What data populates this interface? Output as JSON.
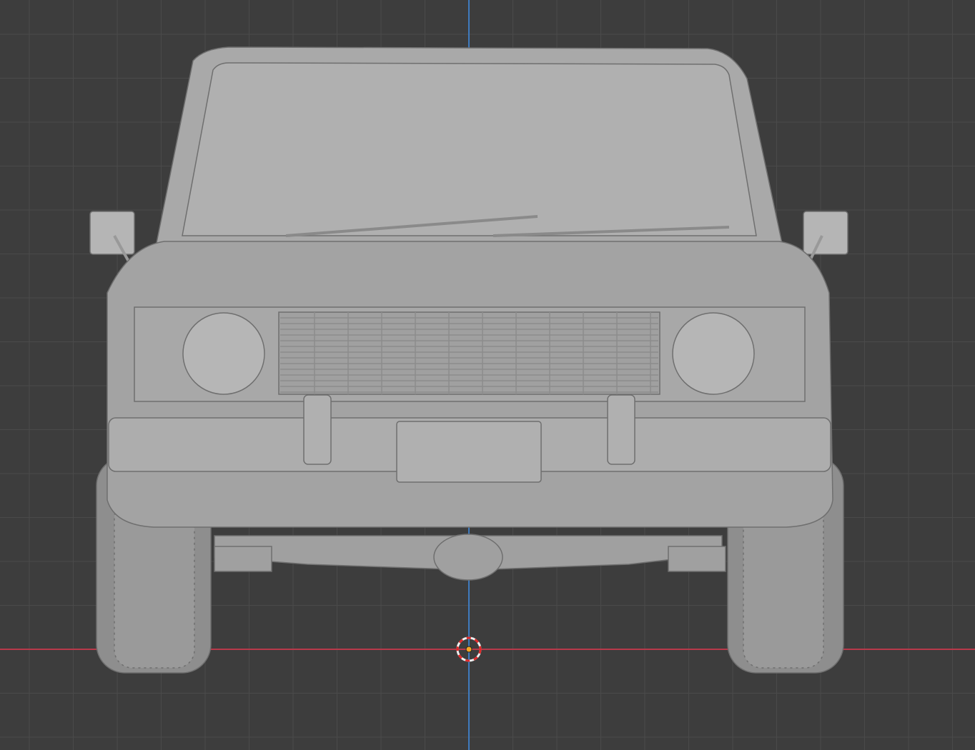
{
  "viewport": {
    "view": "front-orthographic",
    "colors": {
      "background": "#3d3d3d",
      "grid": "#4a4a4a",
      "x_axis": "#b8394a",
      "z_axis": "#3f7bbf",
      "model": "#a6a6a6",
      "model_shadow": "#7e7e7e",
      "model_light": "#bdbdbd",
      "cursor_red": "#e02a2a",
      "cursor_white": "#f0f0f0",
      "origin": "#f5a623"
    },
    "icons": [
      "3d-cursor-icon",
      "origin-point-icon"
    ]
  }
}
